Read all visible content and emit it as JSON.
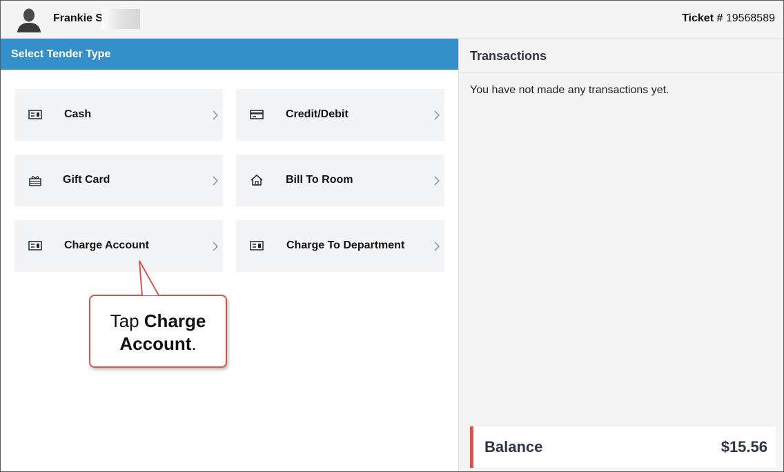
{
  "header": {
    "user_name": "Frankie St",
    "ticket_label": "Ticket #",
    "ticket_number": "19568589"
  },
  "tender": {
    "title": "Select Tender Type",
    "items": [
      {
        "label": "Cash",
        "icon": "cash-icon"
      },
      {
        "label": "Credit/Debit",
        "icon": "credit-card-icon"
      },
      {
        "label": "Gift Card",
        "icon": "gift-icon"
      },
      {
        "label": "Bill To Room",
        "icon": "house-icon"
      },
      {
        "label": "Charge Account",
        "icon": "account-card-icon"
      },
      {
        "label": "Charge To Department",
        "icon": "department-card-icon"
      }
    ]
  },
  "transactions": {
    "title": "Transactions",
    "empty_message": "You have not made any transactions yet.",
    "balance_label": "Balance",
    "balance_value": "$15.56"
  },
  "callout": {
    "prefix": "Tap ",
    "bold": "Charge Account",
    "suffix": "."
  },
  "colors": {
    "header_blue": "#3590c9",
    "accent_red": "#d9534f",
    "tile_bg": "#f3f4f6"
  }
}
